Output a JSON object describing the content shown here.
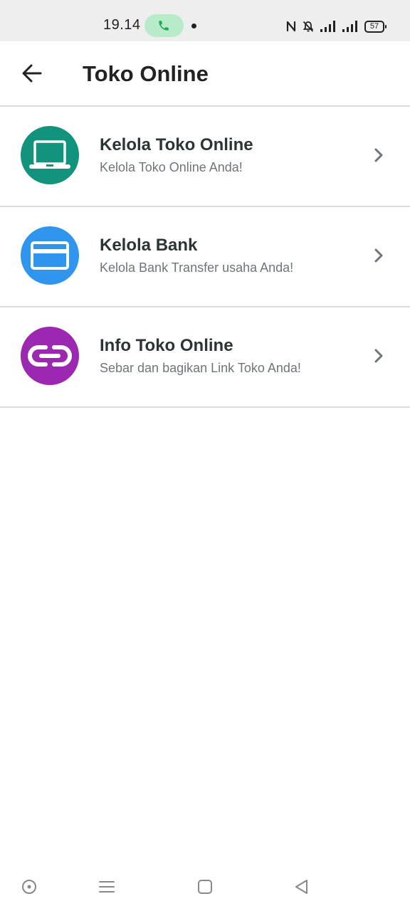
{
  "status_bar": {
    "time": "19.14",
    "battery": "57",
    "call_icon": "phone-icon",
    "icons": [
      "nfc-icon",
      "bell-off-icon",
      "signal-icon",
      "signal-icon",
      "battery-icon"
    ]
  },
  "app_bar": {
    "title": "Toko Online",
    "back_icon": "arrow-left-icon"
  },
  "menu": {
    "items": [
      {
        "title": "Kelola Toko Online",
        "subtitle": "Kelola Toko Online Anda!",
        "icon": "laptop-icon",
        "color": "#12937d"
      },
      {
        "title": "Kelola Bank",
        "subtitle": "Kelola Bank Transfer usaha Anda!",
        "icon": "credit-card-icon",
        "color": "#2f95ee"
      },
      {
        "title": "Info Toko Online",
        "subtitle": "Sebar dan bagikan Link Toko Anda!",
        "icon": "link-icon",
        "color": "#9c27b0"
      }
    ]
  },
  "nav_bar": {
    "icons": [
      "assistant-icon",
      "menu-icon",
      "home-icon",
      "back-icon"
    ]
  },
  "colors": {
    "text_primary": "#2d3436",
    "text_secondary": "#6f7679",
    "divider": "#dddddd",
    "status_bar_bg": "#eeeeee",
    "call_pill": "#b7ebc9"
  }
}
